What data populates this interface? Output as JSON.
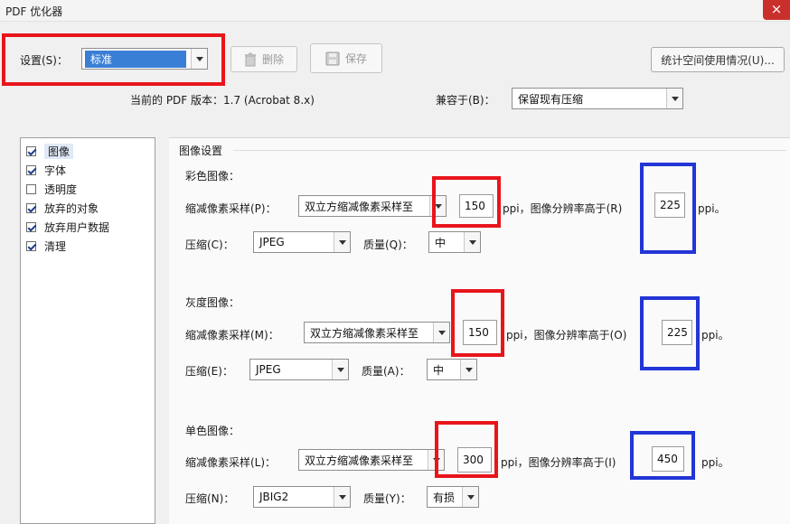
{
  "window": {
    "title": "PDF 优化器",
    "close_symbol": "×"
  },
  "toolbar": {
    "settings_label": "设置(S)：",
    "settings_value": "标准",
    "delete_label": "删除",
    "save_label": "保存",
    "audit_label": "统计空间使用情况(U)..."
  },
  "compat": {
    "current_version_label": "当前的 PDF 版本：1.7 (Acrobat 8.x)",
    "compat_label": "兼容于(B)：",
    "compat_value": "保留现有压缩"
  },
  "sidebar": {
    "items": [
      {
        "label": "图像",
        "checked": true,
        "selected": true
      },
      {
        "label": "字体",
        "checked": true,
        "selected": false
      },
      {
        "label": "透明度",
        "checked": false,
        "selected": false
      },
      {
        "label": "放弃的对象",
        "checked": true,
        "selected": false
      },
      {
        "label": "放弃用户数据",
        "checked": true,
        "selected": false
      },
      {
        "label": "清理",
        "checked": true,
        "selected": false
      }
    ]
  },
  "image_settings": {
    "heading": "图像设置",
    "color": {
      "title": "彩色图像：",
      "downsample_label": "缩减像素采样(P)：",
      "downsample_method": "双立方缩减像素采样至",
      "target_ppi": "150",
      "ppi_above_text": "ppi，图像分辨率高于(R)",
      "threshold_ppi": "225",
      "ppi_suffix": "ppi。",
      "compression_label": "压缩(C)：",
      "compression_value": "JPEG",
      "quality_label": "质量(Q)：",
      "quality_value": "中"
    },
    "gray": {
      "title": "灰度图像：",
      "downsample_label": "缩减像素采样(M)：",
      "downsample_method": "双立方缩减像素采样至",
      "target_ppi": "150",
      "ppi_above_text": "ppi，图像分辨率高于(O)",
      "threshold_ppi": "225",
      "ppi_suffix": "ppi。",
      "compression_label": "压缩(E)：",
      "compression_value": "JPEG",
      "quality_label": "质量(A)：",
      "quality_value": "中"
    },
    "mono": {
      "title": "单色图像：",
      "downsample_label": "缩减像素采样(L)：",
      "downsample_method": "双立方缩减像素采样至",
      "target_ppi": "300",
      "ppi_above_text": "ppi，图像分辨率高于(I)",
      "threshold_ppi": "450",
      "ppi_suffix": "ppi。",
      "compression_label": "压缩(N)：",
      "compression_value": "JBIG2",
      "quality_label": "质量(Y)：",
      "quality_value": "有损"
    }
  },
  "colors": {
    "annotation_red": "#e8151b",
    "annotation_blue": "#2235d6",
    "selection": "#3a7fd6",
    "close": "#c9302c"
  }
}
